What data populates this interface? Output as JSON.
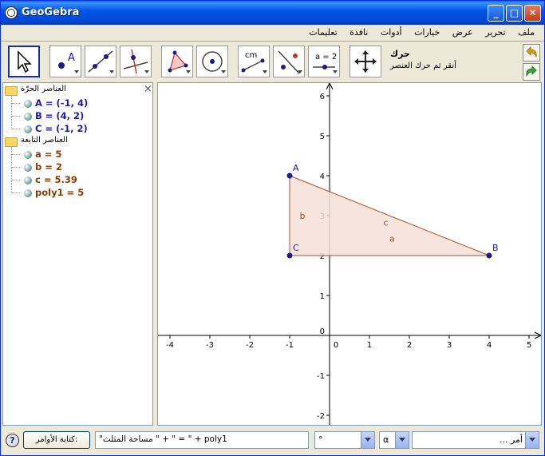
{
  "window": {
    "title": "GeoGebra"
  },
  "menu": [
    "ملف",
    "تحرير",
    "عرض",
    "خيارات",
    "أدوات",
    "نافذة",
    "تعليمات"
  ],
  "tool_help": {
    "name": "حرك",
    "description": "أنقر ثم حرك العنصر"
  },
  "tool_labels": {
    "distance": "cm",
    "slider": "a = 2"
  },
  "algebra": {
    "free_folder": "العناصر الحرّة",
    "dependent_folder": "العناصر التابعة",
    "free_objects": [
      "A = (-1, 4)",
      "B = (4, 2)",
      "C = (-1, 2)"
    ],
    "dependent_objects": [
      "a = 5",
      "b = 2",
      "c = 5.39",
      "poly1 = 5"
    ],
    "close": "×"
  },
  "graph": {
    "x_ticks": [
      "-4",
      "-3",
      "-2",
      "-1",
      "0",
      "1",
      "2",
      "3",
      "4",
      "5"
    ],
    "y_ticks": [
      "-2",
      "-1",
      "0",
      "1",
      "2",
      "3",
      "4",
      "5",
      "6"
    ],
    "points": [
      {
        "label": "A",
        "x": -1,
        "y": 4
      },
      {
        "label": "B",
        "x": 4,
        "y": 2
      },
      {
        "label": "C",
        "x": -1,
        "y": 2
      }
    ],
    "segment_labels": {
      "a": "a",
      "b": "b",
      "c": "c"
    },
    "colors": {
      "point": "#1a1a8c",
      "segment": "#a0522d",
      "fill": "#f3e1d8"
    }
  },
  "input_bar": {
    "help": "?",
    "command_button": "كتابة الأوامر:",
    "input_value": "\"مساحة المثلث \" + \" = \" + poly1",
    "degree": "°",
    "alpha": "α",
    "command_placeholder": "أمر ..."
  }
}
